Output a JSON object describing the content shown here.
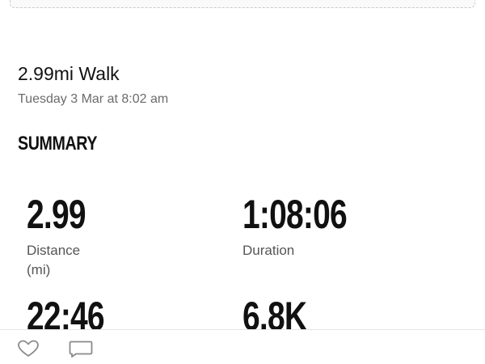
{
  "activity": {
    "title": "2.99mi Walk",
    "date": "Tuesday 3 Mar at 8:02 am"
  },
  "summary": {
    "heading": "SUMMARY",
    "stats": [
      {
        "value": "2.99",
        "label": "Distance\n(mi)"
      },
      {
        "value": "1:08:06",
        "label": "Duration"
      },
      {
        "value": "22:46",
        "label": ""
      },
      {
        "value": "6.8K",
        "label": ""
      }
    ]
  },
  "actions": {
    "like_icon": "heart-outline-icon",
    "comment_icon": "comment-outline-icon"
  },
  "colors": {
    "text_primary": "#111111",
    "text_secondary": "#6b6b6b",
    "icon": "#8a8a8a"
  }
}
